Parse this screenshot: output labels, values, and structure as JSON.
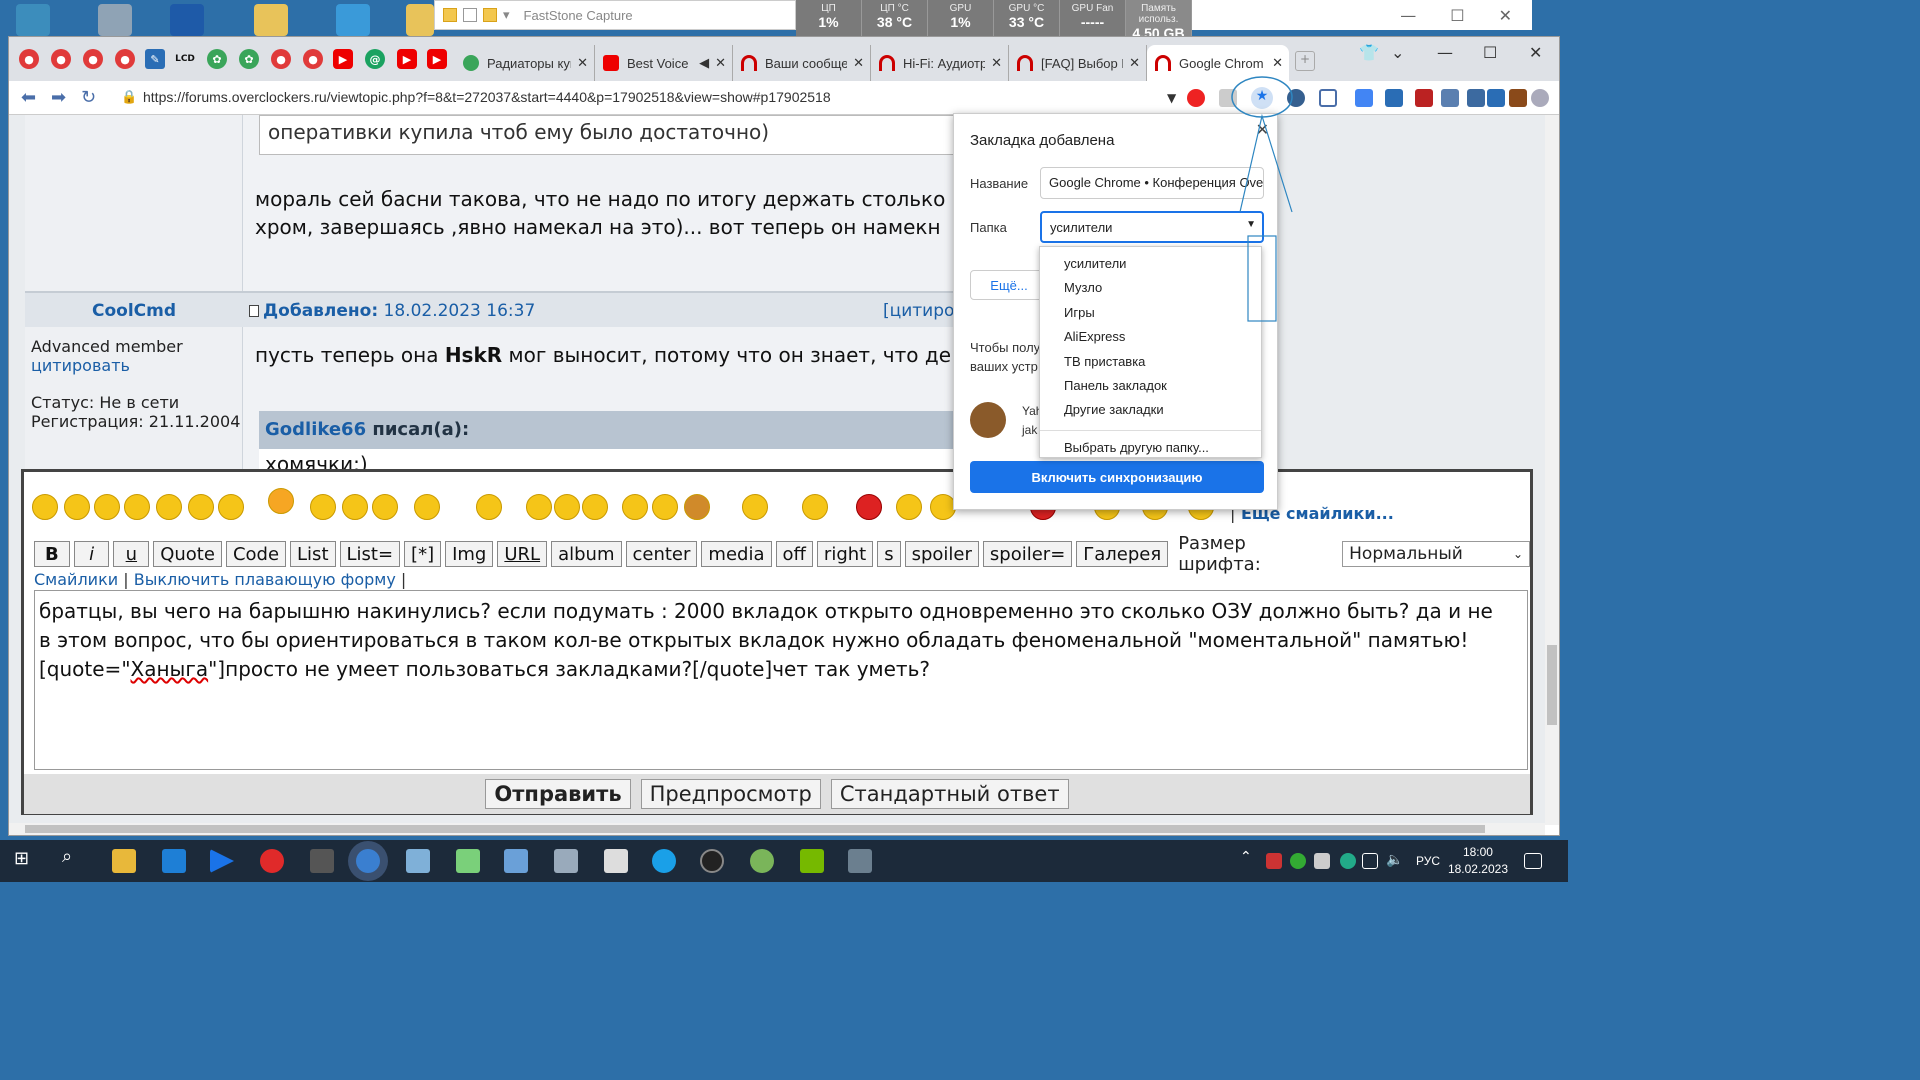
{
  "faststone": {
    "title": "FastStone Capture"
  },
  "sysmon": [
    {
      "label": "ЦП",
      "value": "1%"
    },
    {
      "label": "ЦП °C",
      "value": "38 °C"
    },
    {
      "label": "GPU",
      "value": "1%"
    },
    {
      "label": "GPU °C",
      "value": "33 °C"
    },
    {
      "label": "GPU Fan",
      "value": "-----"
    },
    {
      "label": "Память использ.",
      "value": "4.50 GB"
    }
  ],
  "tabs": [
    {
      "label": "Радиаторы куп"
    },
    {
      "label": "Best Voice"
    },
    {
      "label": "Ваши сообще"
    },
    {
      "label": "Hi-Fi: Аудиотр"
    },
    {
      "label": "[FAQ] Выбор H"
    },
    {
      "label": "Google Chrom"
    }
  ],
  "pinned_text": {
    "lcd": "LCD"
  },
  "address": {
    "url": "https://forums.overclockers.ru/viewtopic.php?f=8&t=272037&start=4440&p=17902518&view=show#p17902518"
  },
  "post1": {
    "quote_text": "оперативки купила чтоб ему было достаточно)",
    "line1": "мораль сей басни такова, что не надо по итогу держать столько",
    "line2": "хром, завершаясь ,явно намекал на это)... вот теперь он намекн"
  },
  "post2": {
    "author": "CoolCmd",
    "added_label": "Добавлено:",
    "added_date": "18.02.2023 16:37",
    "quote_link": "[цитиров",
    "rank": "Advanced member",
    "cite": "цитировать",
    "status": "Статус: Не в сети",
    "reg": "Регистрация: 21.11.2004",
    "text_a": "пусть теперь она ",
    "text_bold": "HskR",
    "text_b": " мог выносит, потому что он знает, что де",
    "quoted_author": "Godlike66",
    "quoted_suffix": " писал(а):",
    "quote_body": "хомячки:)"
  },
  "editor": {
    "more_smiles": "Еще смайлики...",
    "buttons": [
      "B",
      "i",
      "u",
      "Quote",
      "Code",
      "List",
      "List=",
      "[*]",
      "Img",
      "URL",
      "album",
      "center",
      "media",
      "off",
      "right",
      "s",
      "spoiler",
      "spoiler=",
      "Галерея"
    ],
    "fontsize_label": "Размер шрифта:",
    "fontsize_value": "Нормальный",
    "link_smiles": "Смайлики",
    "link_float": "Выключить плавающую форму",
    "sep": "|",
    "text_line1": "братцы, вы чего на барышню накинулись? если подумать : 2000 вкладок открыто одновременно это сколько ОЗУ должно быть? да и не",
    "text_line2": "в этом вопрос, что бы ориентироваться в таком кол-ве открытых вкладок нужно обладать феноменальной \"моментальной\" памятью!",
    "text_line3a": "[quote=\"",
    "text_line3name": "Ханыга",
    "text_line3b": "\"]просто не умеет пользоваться закладками?[/quote]чет так уметь?",
    "submit": "Отправить",
    "preview": "Предпросмотр",
    "standard": "Стандартный ответ"
  },
  "bookmark": {
    "title": "Закладка добавлена",
    "name_label": "Название",
    "name_value": "Google Chrome • Конференция Overclockers",
    "folder_label": "Папка",
    "folder_value": "усилители",
    "more": "Ещё...",
    "sync_text1": "Чтобы полу",
    "sync_text2": "ваших устр",
    "account1": "Yah",
    "account2": "jak",
    "sync_button": "Включить синхронизацию",
    "folders": [
      "усилители",
      "Музло",
      "Игры",
      "AliExpress",
      "ТВ приставка",
      "Панель закладок",
      "Другие закладки"
    ],
    "other_folder": "Выбрать другую папку..."
  },
  "taskbar": {
    "lang": "РУС",
    "time": "18:00",
    "date": "18.02.2023"
  },
  "colors": {
    "accent": "#1a73e8",
    "link": "#1a5ea6",
    "taskbar": "#1c2a3a",
    "annotation": "#2e86c1"
  }
}
